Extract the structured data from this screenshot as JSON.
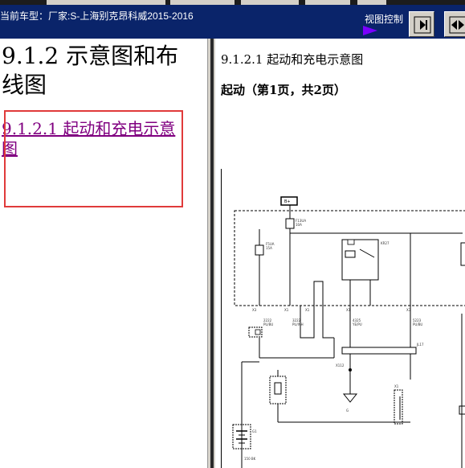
{
  "toolbar": {
    "car_info": "当前车型：厂家:S-上海别克昂科威2015-2016",
    "view_control_label": "视图控制",
    "buttons": [
      {
        "name": "view-next-button"
      },
      {
        "name": "view-more-button"
      }
    ]
  },
  "left": {
    "heading": "9.1.2 示意图和布线图",
    "toc_link": "9.1.2.1 起动和充电示意图"
  },
  "right": {
    "title": "9.1.2.1 起动和充电示意图",
    "subtitle": "起动（第1页，共2页）",
    "diagram": {
      "top_box_label": "B+",
      "fuse_f5": "F5UA\n15A",
      "fuse_f13": "F13UA\n10A",
      "relay": "KR27",
      "connector_labels": [
        "X3",
        "X1",
        "X1",
        "X1",
        "X3"
      ],
      "wire_labels": [
        "2222 PU/BU",
        "3222 PU/WH",
        "4325 YE/PU",
        "5223 PU/BU"
      ],
      "junction": "JL17",
      "x112": "X112",
      "g": "G",
      "battery": "G1",
      "bottom": "150 BK",
      "x1_right": "X1"
    }
  }
}
